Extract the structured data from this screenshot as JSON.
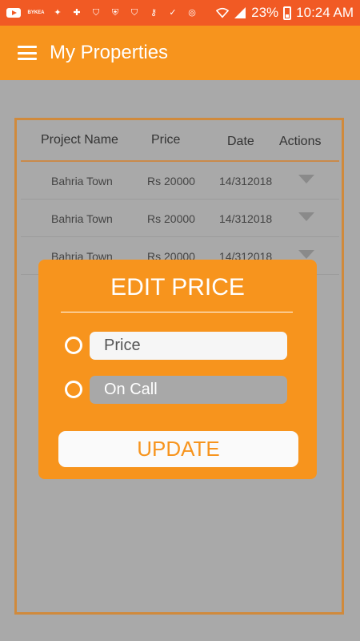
{
  "status_bar": {
    "icons": [
      "youtube-icon",
      "app-badge-icon",
      "fox-icon",
      "health-icon",
      "vpn-icon",
      "shield-icon",
      "vpn-icon",
      "key-icon",
      "check-icon",
      "chrome-icon"
    ],
    "badge_text": "BYKEA",
    "battery": "23%",
    "time": "10:24 AM"
  },
  "app_bar": {
    "title": "My Properties"
  },
  "table": {
    "headers": [
      "Project Name",
      "Price",
      "Date",
      "Actions"
    ],
    "rows": [
      {
        "project": "Bahria Town",
        "price": "Rs 20000",
        "date": "14/312018"
      },
      {
        "project": "Bahria Town",
        "price": "Rs 20000",
        "date": "14/312018"
      },
      {
        "project": "Bahria Town",
        "price": "Rs 20000",
        "date": "14/312018"
      }
    ]
  },
  "dialog": {
    "title": "EDIT PRICE",
    "option_price": "Price",
    "option_on_call": "On Call",
    "update_label": "UPDATE"
  },
  "colors": {
    "status_bar": "#f15a24",
    "accent": "#f7941d",
    "background": "#a9a9a9"
  }
}
